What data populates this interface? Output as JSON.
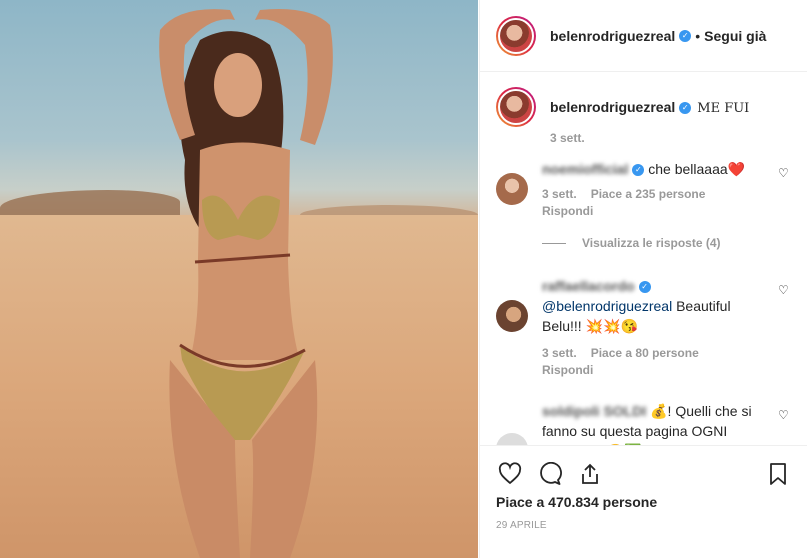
{
  "post": {
    "author": "belenrodriguezreal",
    "follow_status": "Segui già",
    "separator": "•",
    "caption_text": "ME FUI",
    "caption_age": "3 sett."
  },
  "comments": [
    {
      "author": "noemiofficial",
      "text": "che bellaaaa❤️",
      "age": "3 sett.",
      "likes": "Piace a 235 persone",
      "reply_label": "Rispondi",
      "view_replies": "Visualizza le risposte (4)"
    },
    {
      "author": "raffaellacordo",
      "mention": "@belenrodriguezreal",
      "text": " Beautiful Belu!!! 💥💥😘",
      "age": "3 sett.",
      "likes": "Piace a 80 persone",
      "reply_label": "Rispondi"
    },
    {
      "author": "soldipoli",
      "author_suffix": " SOLDI",
      "text": "💰! Quelli che si fanno su questa pagina OGNI GIORNO!!😍✅ Passa a vedere!!"
    }
  ],
  "footer": {
    "likes": "Piace a 470.834 persone",
    "date": "29 APRILE"
  },
  "icons": {
    "like": "heart-icon",
    "comment": "comment-icon",
    "share": "share-icon",
    "save": "bookmark-icon",
    "verified": "verified-badge-icon"
  }
}
